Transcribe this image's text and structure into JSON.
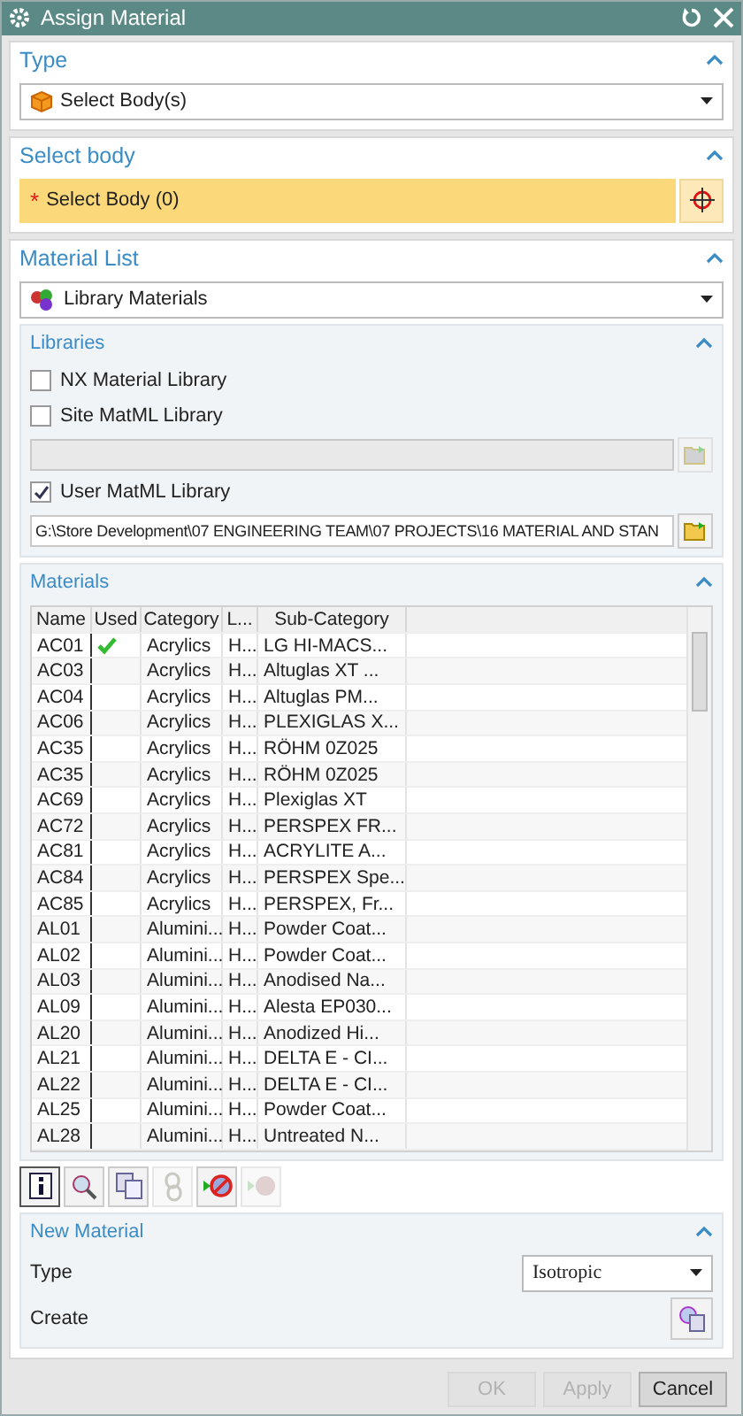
{
  "window": {
    "title": "Assign Material"
  },
  "type_section": {
    "title": "Type",
    "expanded": true,
    "value": "Select Body(s)"
  },
  "select_body_section": {
    "title": "Select body",
    "expanded": true,
    "required_mark": "*",
    "label": "Select Body (0)"
  },
  "material_list_section": {
    "title": "Material List",
    "expanded": true,
    "source": "Library Materials",
    "libraries": {
      "title": "Libraries",
      "expanded": true,
      "items": [
        {
          "kind": "checkbox",
          "label": "NX Material Library",
          "checked": false
        },
        {
          "kind": "checkbox",
          "label": "Site MatML Library",
          "checked": false
        },
        {
          "kind": "path",
          "value": "",
          "disabled": true
        },
        {
          "kind": "checkbox",
          "label": "User MatML Library",
          "checked": true
        },
        {
          "kind": "path",
          "value": "G:\\Store Development\\07 ENGINEERING TEAM\\07 PROJECTS\\16 MATERIAL AND STAN",
          "disabled": false
        }
      ]
    },
    "materials": {
      "title": "Materials",
      "expanded": true,
      "columns": [
        "Name",
        "Used",
        "Category",
        "L...",
        "Sub-Category"
      ],
      "rows": [
        {
          "name": "AC01",
          "used": true,
          "category": "Acrylics",
          "column_4": "H...",
          "sub_category": "LG HI-MACS..."
        },
        {
          "name": "AC03",
          "used": false,
          "category": "Acrylics",
          "column_4": "H...",
          "sub_category": "Altuglas XT ..."
        },
        {
          "name": "AC04",
          "used": false,
          "category": "Acrylics",
          "column_4": "H...",
          "sub_category": "Altuglas PM..."
        },
        {
          "name": "AC06",
          "used": false,
          "category": "Acrylics",
          "column_4": "H...",
          "sub_category": "PLEXIGLAS X..."
        },
        {
          "name": "AC35",
          "used": false,
          "category": "Acrylics",
          "column_4": "H...",
          "sub_category": "RÖHM 0Z025"
        },
        {
          "name": "AC35",
          "used": false,
          "category": "Acrylics",
          "column_4": "H...",
          "sub_category": "RÖHM 0Z025"
        },
        {
          "name": "AC69",
          "used": false,
          "category": "Acrylics",
          "column_4": "H...",
          "sub_category": "Plexiglas XT"
        },
        {
          "name": "AC72",
          "used": false,
          "category": "Acrylics",
          "column_4": "H...",
          "sub_category": "PERSPEX FR..."
        },
        {
          "name": "AC81",
          "used": false,
          "category": "Acrylics",
          "column_4": "H...",
          "sub_category": "ACRYLITE A..."
        },
        {
          "name": "AC84",
          "used": false,
          "category": "Acrylics",
          "column_4": "H...",
          "sub_category": "PERSPEX Spe..."
        },
        {
          "name": "AC85",
          "used": false,
          "category": "Acrylics",
          "column_4": "H...",
          "sub_category": "PERSPEX, Fr..."
        },
        {
          "name": "AL01",
          "used": false,
          "category": "Alumini...",
          "column_4": "H...",
          "sub_category": "Powder Coat..."
        },
        {
          "name": "AL02",
          "used": false,
          "category": "Alumini...",
          "column_4": "H...",
          "sub_category": "Powder Coat..."
        },
        {
          "name": "AL03",
          "used": false,
          "category": "Alumini...",
          "column_4": "H...",
          "sub_category": "Anodised Na..."
        },
        {
          "name": "AL09",
          "used": false,
          "category": "Alumini...",
          "column_4": "H...",
          "sub_category": "Alesta EP030..."
        },
        {
          "name": "AL20",
          "used": false,
          "category": "Alumini...",
          "column_4": "H...",
          "sub_category": "Anodized Hi..."
        },
        {
          "name": "AL21",
          "used": false,
          "category": "Alumini...",
          "column_4": "H...",
          "sub_category": "DELTA E - CI..."
        },
        {
          "name": "AL22",
          "used": false,
          "category": "Alumini...",
          "column_4": "H...",
          "sub_category": "DELTA E - CI..."
        },
        {
          "name": "AL25",
          "used": false,
          "category": "Alumini...",
          "column_4": "H...",
          "sub_category": "Powder Coat..."
        },
        {
          "name": "AL28",
          "used": false,
          "category": "Alumini...",
          "column_4": "H...",
          "sub_category": "Untreated N..."
        }
      ]
    },
    "toolbar": [
      {
        "kind": "info",
        "disabled": false
      },
      {
        "kind": "inspect",
        "disabled": false
      },
      {
        "kind": "copy",
        "disabled": false
      },
      {
        "kind": "link",
        "disabled": true
      },
      {
        "kind": "remove",
        "disabled": false
      },
      {
        "kind": "export",
        "disabled": true
      }
    ],
    "new_material": {
      "title": "New Material",
      "expanded": true,
      "type_label": "Type",
      "type_value": "Isotropic",
      "create_label": "Create"
    }
  },
  "buttons": [
    {
      "label": "OK",
      "disabled": true
    },
    {
      "label": "Apply",
      "disabled": true
    },
    {
      "label": "Cancel",
      "disabled": false
    }
  ]
}
